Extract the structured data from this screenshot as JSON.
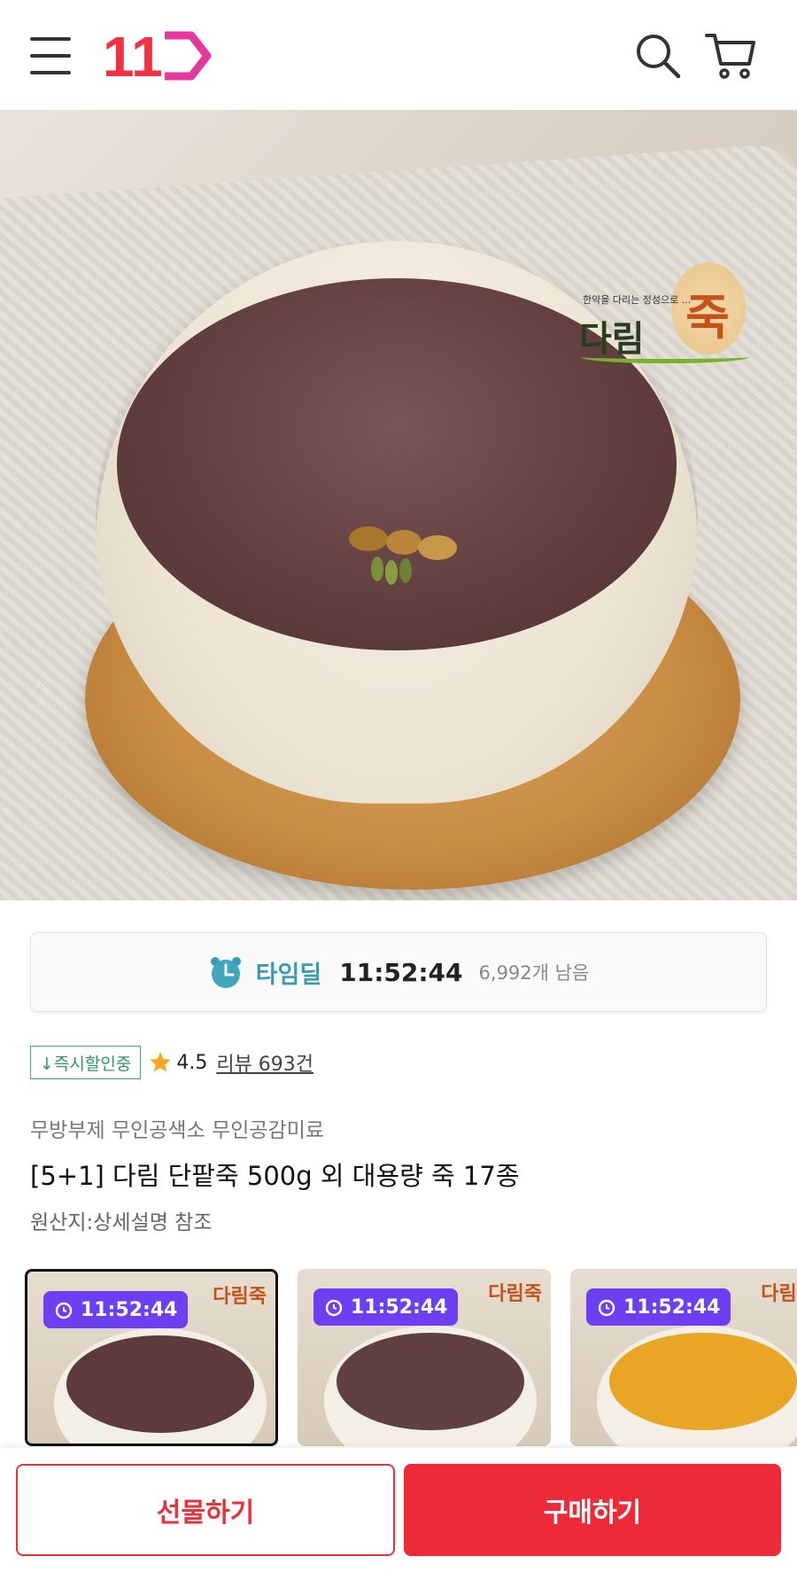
{
  "header": {
    "logo_text": "11",
    "brand_color": "#f43142",
    "icons": [
      "menu-icon",
      "search-icon",
      "cart-icon"
    ]
  },
  "hero": {
    "brand_logo": {
      "tagline": "한약을 다리는 정성으로 ...",
      "name": "다림",
      "name_accent": "죽"
    },
    "carousel": {
      "current": 1,
      "total": 3
    }
  },
  "timedeal": {
    "label": "타임딜",
    "time": "11:52:44",
    "remaining": "6,992개 남음",
    "accent_color": "#3a9bb3"
  },
  "product": {
    "discount_badge": "↓즉시할인중",
    "rating": "4.5",
    "review_text": "리뷰 693건",
    "tags": "무방부제 무인공색소 무인공감미료",
    "title": "[5+1] 다림 단팥죽 500g 외 대용량 죽 17종",
    "origin": "원산지:상세설명 참조"
  },
  "thumbnails": [
    {
      "timer": "11:52:44",
      "logo": "다림죽",
      "soup_color": "#5e3b3b"
    },
    {
      "timer": "11:52:44",
      "logo": "다림죽",
      "soup_color": "#604040"
    },
    {
      "timer": "11:52:44",
      "logo": "다림죽",
      "soup_color": "#e9a624"
    }
  ],
  "bottom_bar": {
    "gift_label": "선물하기",
    "buy_label": "구매하기",
    "cta_color": "#ec2a38"
  }
}
